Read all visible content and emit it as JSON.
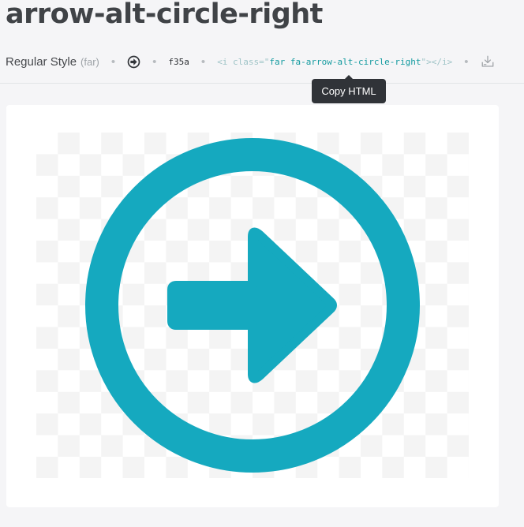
{
  "icon": {
    "name": "arrow-alt-circle-right",
    "style_label": "Regular Style",
    "style_prefix": "(far)",
    "unicode": "f35a",
    "html_snippet": {
      "open_tag": "<i class=\"",
      "class_value": "far fa-arrow-alt-circle-right",
      "close_tag": "\"></i>"
    },
    "color": "#15a9bf"
  },
  "tooltip": {
    "text": "Copy HTML"
  },
  "colors": {
    "title": "#404347",
    "code_accent": "#129a9f",
    "tooltip_bg": "#303338",
    "page_bg": "#f5f5f7"
  },
  "icons": {
    "small_preview": "arrow-alt-circle-right-icon",
    "download": "download-icon",
    "large_preview": "arrow-alt-circle-right-icon"
  }
}
